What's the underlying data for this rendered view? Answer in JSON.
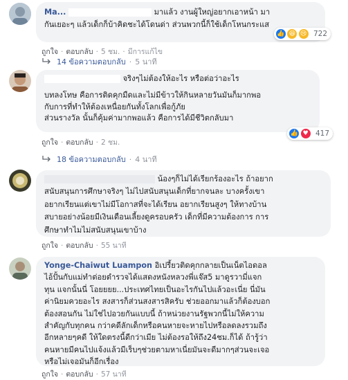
{
  "comments": [
    {
      "author": "Ma...",
      "lines": [
        "มาแล้ว งานผู้ใหญ่อยากเอาหน้า มา",
        "กันเยอะๆ แล้วเด็กก็บ้าคิดชะได้โดนด่า ส่วนพวกนี้ก็ใช้เด็กโหนกระแส"
      ],
      "actions": {
        "like": "ถูกใจ",
        "reply": "ตอบกลับ",
        "time": "5 ชม.",
        "edited": "มีการแก้ไข"
      },
      "reaction_count": "722",
      "reply_summary": {
        "text": "14 ข้อความตอบกลับ",
        "time": "5 นาที"
      }
    },
    {
      "author": "",
      "lines": [
        "จริงๆไม่ต้องให้อะไร หรือต่อว่าอะไร",
        "",
        "บทลงโทษ คือการติดคุกมืดและไม่มีข้าวให้กินหลายวันมันก็มากพอ",
        "กับการที่ทำให้ต้องเหนื่อยกันทั้งโลกเพื่อกู้ภัย",
        "ส่วนรางวัล นั้นก็คุ้มค่ามากพอแล้ว คือการได้มีชีวิตกลับมา"
      ],
      "actions": {
        "like": "ถูกใจ",
        "reply": "ตอบกลับ",
        "time": "2 ชม."
      },
      "reaction_count": "417",
      "reply_summary": {
        "text": "18 ข้อความตอบกลับ",
        "time": "4 นาที"
      }
    },
    {
      "author": "",
      "lines": [
        "น้องๆก็ไม่ได้เรียกร้องอะไร ถ้าอยาก",
        "สนับสนุนการศึกษาจริงๆ ไม่ไปสนับสนุนเด็กที่ยากจนละ บางครั้งเขา",
        "อยากเรียนแต่เขาไม่มีโอกาสที่จะได้เรียน อยากเรียนสูงๆ ให้ทางบ้าน",
        "สบายอย่างน้อยมีเงินเดือนเลี้ยงดูครอบครัว เด็กที่มีความต้องการ การ",
        "ศึกษาทำไมไม่สนับสนุนเขาบ้าง"
      ],
      "actions": {
        "like": "ถูกใจ",
        "reply": "ตอบกลับ",
        "time": "55 นาที"
      }
    },
    {
      "author": "Yonge-Chaiwut Luampon",
      "lines": [
        "อิเปรี้ยวติดคุกกลายเป็นเน็ตไอดอล",
        "ไอ้ปั้นกับแม่ทำต่อยตำรวจได้แสดงหนังหลวงพี่แจ๊ส5 มาดูรวามี่แจก",
        "ทุน แจกนั้นนี่ โอยยยย...ประเทศไทยเป็นอะไรกันไปแล้วอะเนี่ย นี่มัน",
        "ค่านิยมควยอะไร สงสารก็ส่วนสงสารสิครับ ช่วยออกมาแล้วก็ต้องบอก",
        "ต้องสอนกัน ไม่ใช่ไปอวยกันแบบนี้ ถ้าหน่วยงานรัฐพวกนี้ไม่ให้ความ",
        "สำคัญกับทุกคน กว่าคดีลักเด็กหรือคนหายจะหายไปหรือลดลงรวมถึง",
        "อีกหลายๆคดี ให้ใดตรงนี้ดีกว่าเมีย ไม่ต้องรอให้ถึง24ชม.ก็ได้ ถ้ารู้ว่า",
        "คนหายมีคนไปแจ้งแล้วมีเร็บๆช่วยตามหาเนี่ยมันจะดีมากๆส่วนจะเจอ",
        "หรือไม่เจอมันก็อีกเรื่อง"
      ],
      "actions": {
        "like": "ถูกใจ",
        "reply": "ตอบกลับ",
        "time": "57 นาที"
      }
    }
  ],
  "colors": {
    "bubble": "#f2f3f5",
    "link": "#385898",
    "meta": "#90949c",
    "like_blue": "#1877f2",
    "love_red": "#f0284a",
    "haha_yellow": "#f7b928"
  },
  "icons": {
    "reply_arrow": "reply-arrow-icon",
    "like": "like-icon",
    "love": "love-icon",
    "haha": "haha-icon",
    "sad": "sad-icon"
  }
}
